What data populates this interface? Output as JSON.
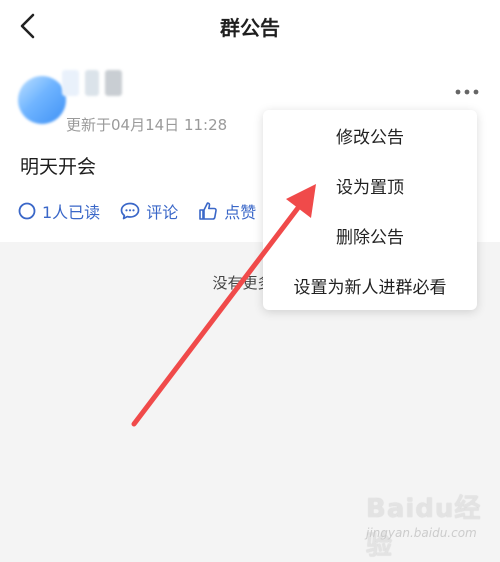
{
  "header": {
    "title": "群公告"
  },
  "announcement": {
    "updated_text": "更新于04月14日 11:28",
    "content": "明天开会",
    "actions": {
      "read_label": "1人已读",
      "comment_label": "评论",
      "like_label": "点赞"
    }
  },
  "empty_text": "没有更多了",
  "menu": {
    "items": [
      "修改公告",
      "设为置顶",
      "删除公告",
      "设置为新人进群必看"
    ]
  },
  "watermark": {
    "brand": "Baidu经验",
    "url": "jingyan.baidu.com"
  },
  "colors": {
    "accent": "#3a67c8",
    "arrow": "#f04a4a",
    "text_secondary": "#9a9a9a"
  }
}
